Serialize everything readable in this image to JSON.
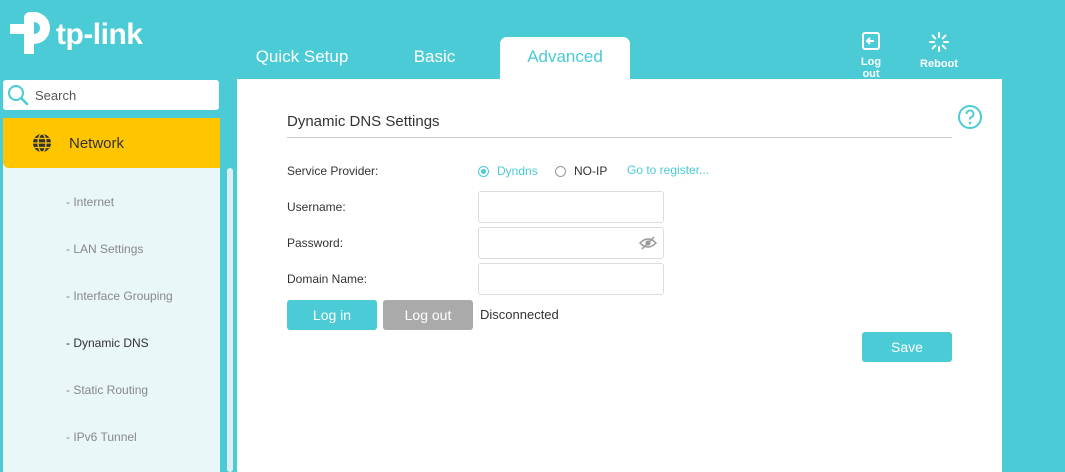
{
  "brand": {
    "logo_text": "tp-link"
  },
  "tabs": [
    {
      "label": "Quick Setup"
    },
    {
      "label": "Basic"
    },
    {
      "label": "Advanced"
    }
  ],
  "top_actions": {
    "logout_label": "Log out",
    "reboot_label": "Reboot"
  },
  "search": {
    "placeholder": "Search"
  },
  "sidebar": {
    "section": {
      "label": "Network",
      "icon": "globe-icon"
    },
    "items": [
      {
        "label": "- Internet"
      },
      {
        "label": "- LAN Settings"
      },
      {
        "label": "- Interface Grouping"
      },
      {
        "label": "- Dynamic DNS",
        "active": true
      },
      {
        "label": "- Static Routing"
      },
      {
        "label": "- IPv6 Tunnel"
      }
    ]
  },
  "main": {
    "title": "Dynamic DNS Settings",
    "service_provider": {
      "label": "Service Provider:",
      "options": [
        {
          "label": "Dyndns",
          "checked": true
        },
        {
          "label": "NO-IP",
          "checked": false
        }
      ],
      "register_link": "Go to register..."
    },
    "username": {
      "label": "Username:",
      "value": ""
    },
    "password": {
      "label": "Password:",
      "value": ""
    },
    "domain_name": {
      "label": "Domain Name:",
      "value": ""
    },
    "login_button": "Log in",
    "logout_button": "Log out",
    "status": "Disconnected",
    "save_button": "Save"
  },
  "colors": {
    "accent": "#4acbd6",
    "highlight": "#ffc600",
    "disabled_button": "#aaaaaa",
    "sidebar_bg": "#e9f7f8"
  }
}
